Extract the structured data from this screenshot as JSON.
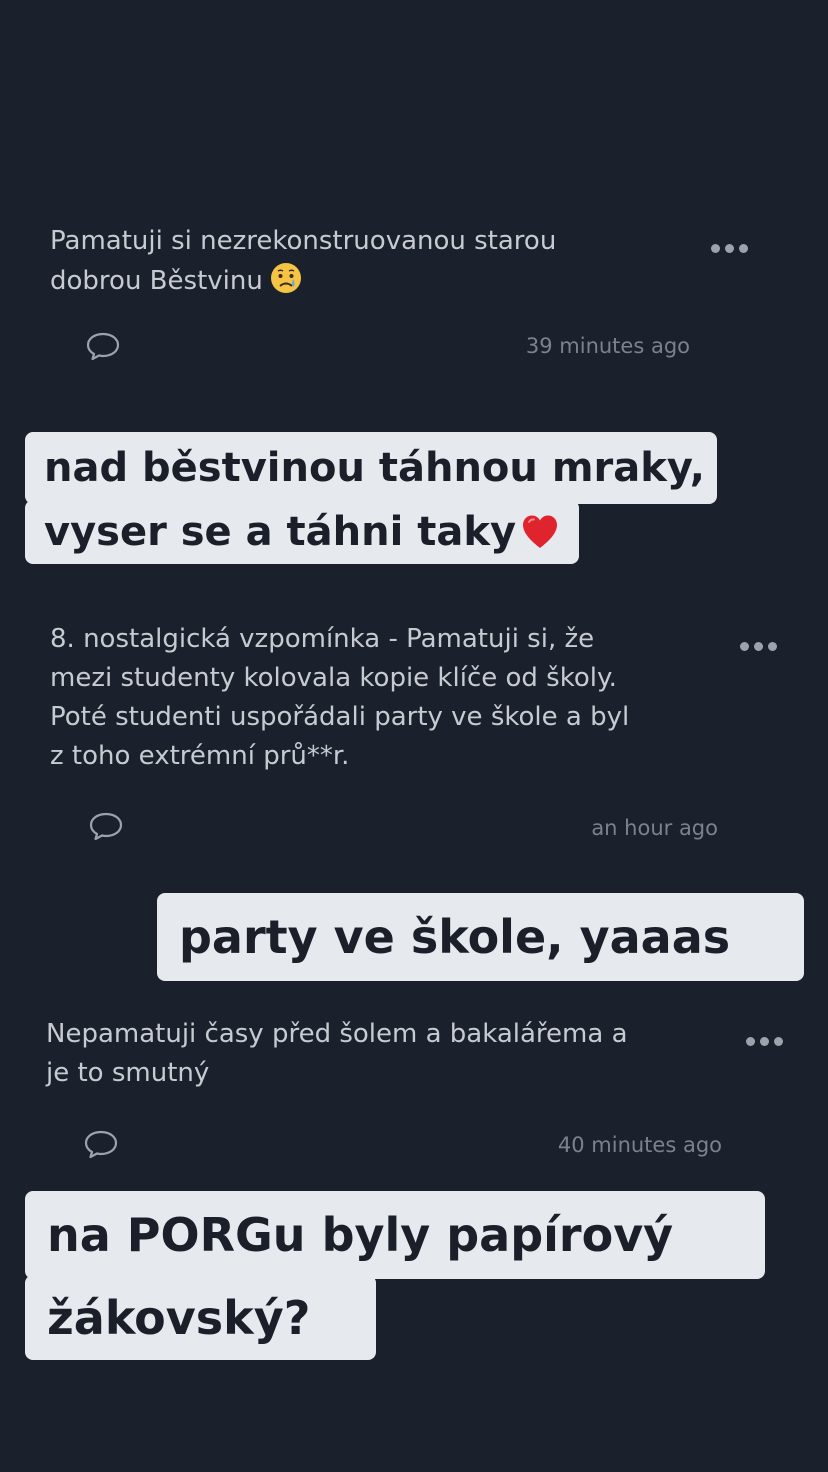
{
  "comments": [
    {
      "text": "Pamatuji si nezrekonstruovanou starou\ndobrou Běstvinu",
      "emoji": "crying-face",
      "time": "39 minutes ago"
    },
    {
      "text": "8. nostalgická vzpomínka - Pamatuji si, že\nmezi studenty kolovala kopie klíče od školy.\nPoté studenti uspořádali party ve škole a byl\nz toho extrémní prů**r.",
      "time": "an hour ago"
    },
    {
      "text": "Nepamatuji časy před šolem a bakalářema a\nje to smutný",
      "time": "40 minutes ago"
    }
  ],
  "stickers": [
    {
      "line1": "nad běstvinou táhnou mraky,",
      "line2": "vyser se a táhni taky",
      "emoji": "red-heart"
    },
    {
      "line1": "party ve škole, yaaas"
    },
    {
      "line1": "na PORGu byly papírový",
      "line2": "žákovský?"
    }
  ],
  "colors": {
    "background": "#1b212c",
    "sticker_bg": "#e6e9ed",
    "sticker_text": "#1a1f2a",
    "heart": "#e0242e"
  }
}
